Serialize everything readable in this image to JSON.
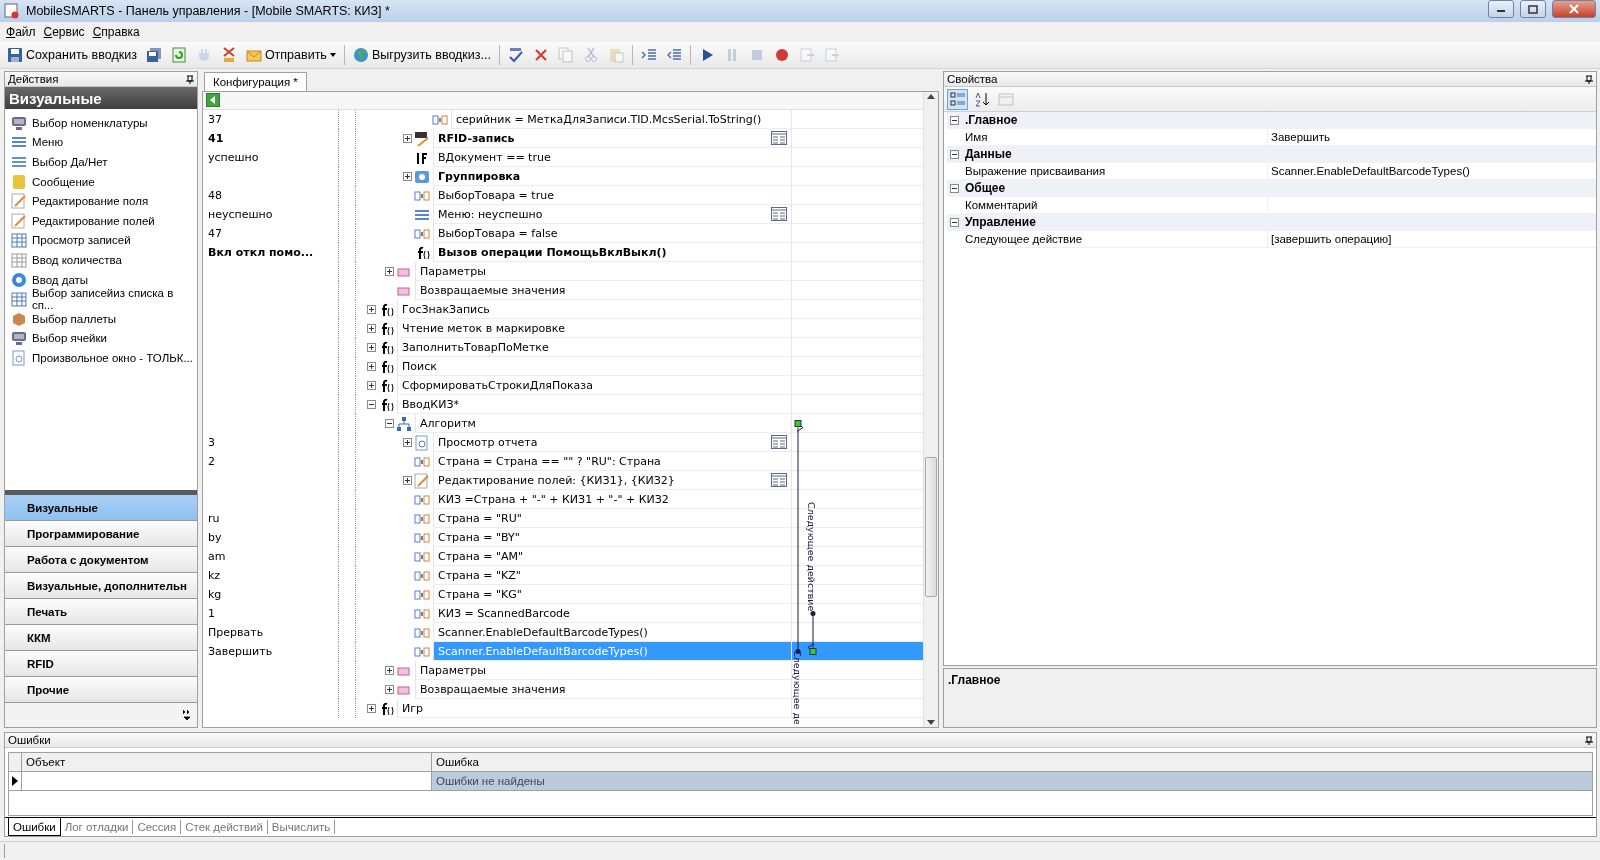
{
  "window": {
    "title": "MobileSMARTS - Панель управления - [Mobile SMARTS: КИЗ] *"
  },
  "menu": [
    "Файл",
    "Сервис",
    "Справка"
  ],
  "toolbar": [
    {
      "kind": "save",
      "label": "Сохранить вводкиз",
      "disabled": false
    },
    {
      "kind": "save-all",
      "disabled": false
    },
    {
      "kind": "refresh",
      "disabled": false
    },
    {
      "kind": "plug",
      "disabled": true
    },
    {
      "kind": "remove",
      "disabled": false
    },
    {
      "kind": "send",
      "label": "Отправить",
      "disabled": false
    },
    {
      "kind": "separator"
    },
    {
      "kind": "export",
      "label": "Выгрузить вводкиз...",
      "disabled": false
    },
    {
      "kind": "separator"
    },
    {
      "kind": "check",
      "disabled": false
    },
    {
      "kind": "delete",
      "disabled": false
    },
    {
      "kind": "copy",
      "disabled": true
    },
    {
      "kind": "cut",
      "disabled": true
    },
    {
      "kind": "paste",
      "disabled": true
    },
    {
      "kind": "separator"
    },
    {
      "kind": "indent",
      "disabled": false
    },
    {
      "kind": "outdent",
      "disabled": false
    },
    {
      "kind": "separator"
    },
    {
      "kind": "play",
      "disabled": false
    },
    {
      "kind": "pause",
      "disabled": true
    },
    {
      "kind": "stop",
      "disabled": true
    },
    {
      "kind": "record",
      "disabled": false
    },
    {
      "kind": "step",
      "disabled": true
    },
    {
      "kind": "step",
      "disabled": true
    }
  ],
  "actions_panel": {
    "title": "Действия",
    "group_title": "Визуальные",
    "items": [
      {
        "kind": "nomenclature",
        "label": "Выбор номенклатуры"
      },
      {
        "kind": "menu",
        "label": "Меню"
      },
      {
        "kind": "yes-no",
        "label": "Выбор Да/Нет"
      },
      {
        "kind": "message",
        "label": "Сообщение"
      },
      {
        "kind": "edit",
        "label": "Редактирование поля"
      },
      {
        "kind": "edit",
        "label": "Редактирование полей"
      },
      {
        "kind": "records",
        "label": "Просмотр записей"
      },
      {
        "kind": "quantity",
        "label": "Ввод количества"
      },
      {
        "kind": "date",
        "label": "Ввод даты"
      },
      {
        "kind": "records",
        "label": "Выбор записейиз списка в сп..."
      },
      {
        "kind": "pallet",
        "label": "Выбор паллеты"
      },
      {
        "kind": "nomenclature",
        "label": "Выбор ячейки"
      },
      {
        "kind": "report",
        "label": "Произвольное окно - ТОЛЬК..."
      }
    ],
    "categories": [
      {
        "label": "Визуальные",
        "selected": true
      },
      {
        "label": "Программирование",
        "selected": false
      },
      {
        "label": "Работа с документом",
        "selected": false
      },
      {
        "label": "Визуальные, дополнительн",
        "selected": false
      },
      {
        "label": "Печать",
        "selected": false
      },
      {
        "label": "ККМ",
        "selected": false
      },
      {
        "label": "RFID",
        "selected": false
      },
      {
        "label": "Прочие",
        "selected": false
      }
    ]
  },
  "editor": {
    "tab": {
      "label": "Конфигурация *",
      "selected": true
    },
    "tree": [
      {
        "children": [
          {
            "children": [
              {
                "children": [
                  {
                    "num": "37",
                    "kind": "assign",
                    "text": "серийник = МеткаДляЗаписи.TID.McsSerial.ToString()",
                    "bold": false,
                    "form": false,
                    "selected": false
                  }
                ]
              },
              {
                "num": "41",
                "kind": "rfid",
                "text": "RFID-запись",
                "bold": true,
                "expanded": false,
                "form": true,
                "selected": false
              },
              {
                "num": "успешно",
                "kind": "if",
                "text": "ВДокумент == true",
                "bold": false,
                "form": false,
                "selected": false
              },
              {
                "kind": "group",
                "text": "Группировка",
                "bold": true,
                "expanded": false,
                "form": false,
                "selected": false
              },
              {
                "num": "48",
                "kind": "assign",
                "text": "ВыборТовара = true",
                "bold": false,
                "form": false,
                "selected": false
              },
              {
                "num": "неуспешно",
                "kind": "menu",
                "text": "Меню: неуспешно",
                "bold": false,
                "form": true,
                "selected": false
              },
              {
                "num": "47",
                "kind": "assign",
                "text": "ВыборТовара = false",
                "bold": false,
                "form": false,
                "selected": false
              },
              {
                "num": "Вкл откл помо...",
                "kind": "function",
                "text": "Вызов операции ПомощьВклВыкл()",
                "bold": true,
                "form": false,
                "selected": false
              }
            ]
          },
          {
            "kind": "params",
            "text": "Параметры",
            "bold": false,
            "expanded": false,
            "form": false,
            "selected": false
          },
          {
            "kind": "params",
            "text": "Возвращаемые значения",
            "bold": false,
            "form": false,
            "selected": false
          }
        ]
      },
      {
        "kind": "function",
        "text": "ГосЗнакЗапись",
        "bold": false,
        "expanded": false,
        "form": false,
        "selected": false
      },
      {
        "kind": "function",
        "text": "Чтение меток в маркировке",
        "bold": false,
        "expanded": false,
        "form": false,
        "selected": false
      },
      {
        "kind": "function",
        "text": "ЗаполнитьТоварПоМетке",
        "bold": false,
        "expanded": false,
        "form": false,
        "selected": false
      },
      {
        "kind": "function",
        "text": "Поиск",
        "bold": false,
        "expanded": false,
        "form": false,
        "selected": false
      },
      {
        "kind": "function",
        "text": "СформироватьСтрокиДляПоказа",
        "bold": false,
        "expanded": false,
        "form": false,
        "selected": false
      },
      {
        "kind": "function",
        "text": "ВводКИЗ*",
        "bold": false,
        "expanded": true,
        "form": false,
        "selected": false,
        "children": [
          {
            "kind": "algorithm",
            "text": "Алгоритм",
            "bold": false,
            "expanded": true,
            "form": false,
            "selected": false,
            "children": [
              {
                "num": "3",
                "kind": "report",
                "text": "Просмотр отчета",
                "bold": false,
                "expanded": false,
                "form": true,
                "selected": false
              },
              {
                "num": "2",
                "kind": "assign",
                "text": "Страна = Страна == \"\" ? \"RU\": Страна",
                "bold": false,
                "form": false,
                "selected": false
              },
              {
                "kind": "edit",
                "text": "Редактирование полей: {КИЗ1}, {КИЗ2}",
                "bold": false,
                "expanded": false,
                "form": true,
                "selected": false
              },
              {
                "kind": "assign",
                "text": "КИЗ =Страна + \"-\" + КИЗ1 + \"-\" + КИЗ2",
                "bold": false,
                "form": false,
                "selected": false
              },
              {
                "num": "ru",
                "kind": "assign",
                "text": "Страна = \"RU\"",
                "bold": false,
                "form": false,
                "selected": false
              },
              {
                "num": "by",
                "kind": "assign",
                "text": "Страна = \"BY\"",
                "bold": false,
                "form": false,
                "selected": false
              },
              {
                "num": "am",
                "kind": "assign",
                "text": "Страна = \"AM\"",
                "bold": false,
                "form": false,
                "selected": false
              },
              {
                "num": "kz",
                "kind": "assign",
                "text": "Страна = \"KZ\"",
                "bold": false,
                "form": false,
                "selected": false
              },
              {
                "num": "kg",
                "kind": "assign",
                "text": "Страна = \"KG\"",
                "bold": false,
                "form": false,
                "selected": false
              },
              {
                "num": "1",
                "kind": "assign",
                "text": "КИЗ = ScannedBarcode",
                "bold": false,
                "form": false,
                "selected": false
              },
              {
                "num": "Прервать",
                "kind": "assign",
                "text": "Scanner.EnableDefaultBarcodeTypes()",
                "bold": false,
                "form": false,
                "selected": false
              },
              {
                "num": "Завершить",
                "kind": "assign",
                "text": "Scanner.EnableDefaultBarcodeTypes()",
                "bold": false,
                "form": false,
                "selected": true
              }
            ]
          },
          {
            "kind": "params",
            "text": "Параметры",
            "bold": false,
            "expanded": false,
            "form": false,
            "selected": false
          },
          {
            "kind": "params",
            "text": "Возвращаемые значения",
            "bold": false,
            "expanded": false,
            "form": false,
            "selected": false
          }
        ]
      },
      {
        "kind": "function",
        "text": "Игр",
        "bold": false,
        "expanded": false,
        "form": false,
        "selected": false
      }
    ],
    "links": [
      {
        "label": "Следующее действие"
      },
      {
        "label": "Следующее де"
      }
    ]
  },
  "properties": {
    "title": "Свойства",
    "tools": [
      {
        "kind": "categorized",
        "selected": true
      },
      {
        "kind": "alphabetical",
        "selected": false
      },
      {
        "kind": "pages",
        "disabled": true
      }
    ],
    "groups": [
      {
        "title": ".Главное",
        "expanded": true,
        "rows": [
          {
            "name": "Имя",
            "value": "Завершить"
          }
        ]
      },
      {
        "title": "Данные",
        "expanded": true,
        "rows": [
          {
            "name": "Выражение присваивания",
            "value": "Scanner.EnableDefaultBarcodeTypes()"
          }
        ]
      },
      {
        "title": "Общее",
        "expanded": true,
        "rows": [
          {
            "name": "Комментарий"
          }
        ]
      },
      {
        "title": "Управление",
        "expanded": true,
        "rows": [
          {
            "name": "Следующее действие",
            "value": "[завершить операцию]"
          }
        ]
      }
    ],
    "description_title": ".Главное"
  },
  "errors_panel": {
    "title": "Ошибки",
    "columns": [
      "Объект",
      "Ошибка"
    ],
    "rows": [
      {
        "error": "Ошибки не найдены",
        "current": true
      }
    ],
    "tabs": [
      {
        "label": "Ошибки",
        "selected": true
      },
      {
        "label": "Лог отладки",
        "selected": false
      },
      {
        "label": "Сессия",
        "selected": false
      },
      {
        "label": "Стек действий",
        "selected": false
      },
      {
        "label": "Вычислить",
        "selected": false
      }
    ]
  }
}
